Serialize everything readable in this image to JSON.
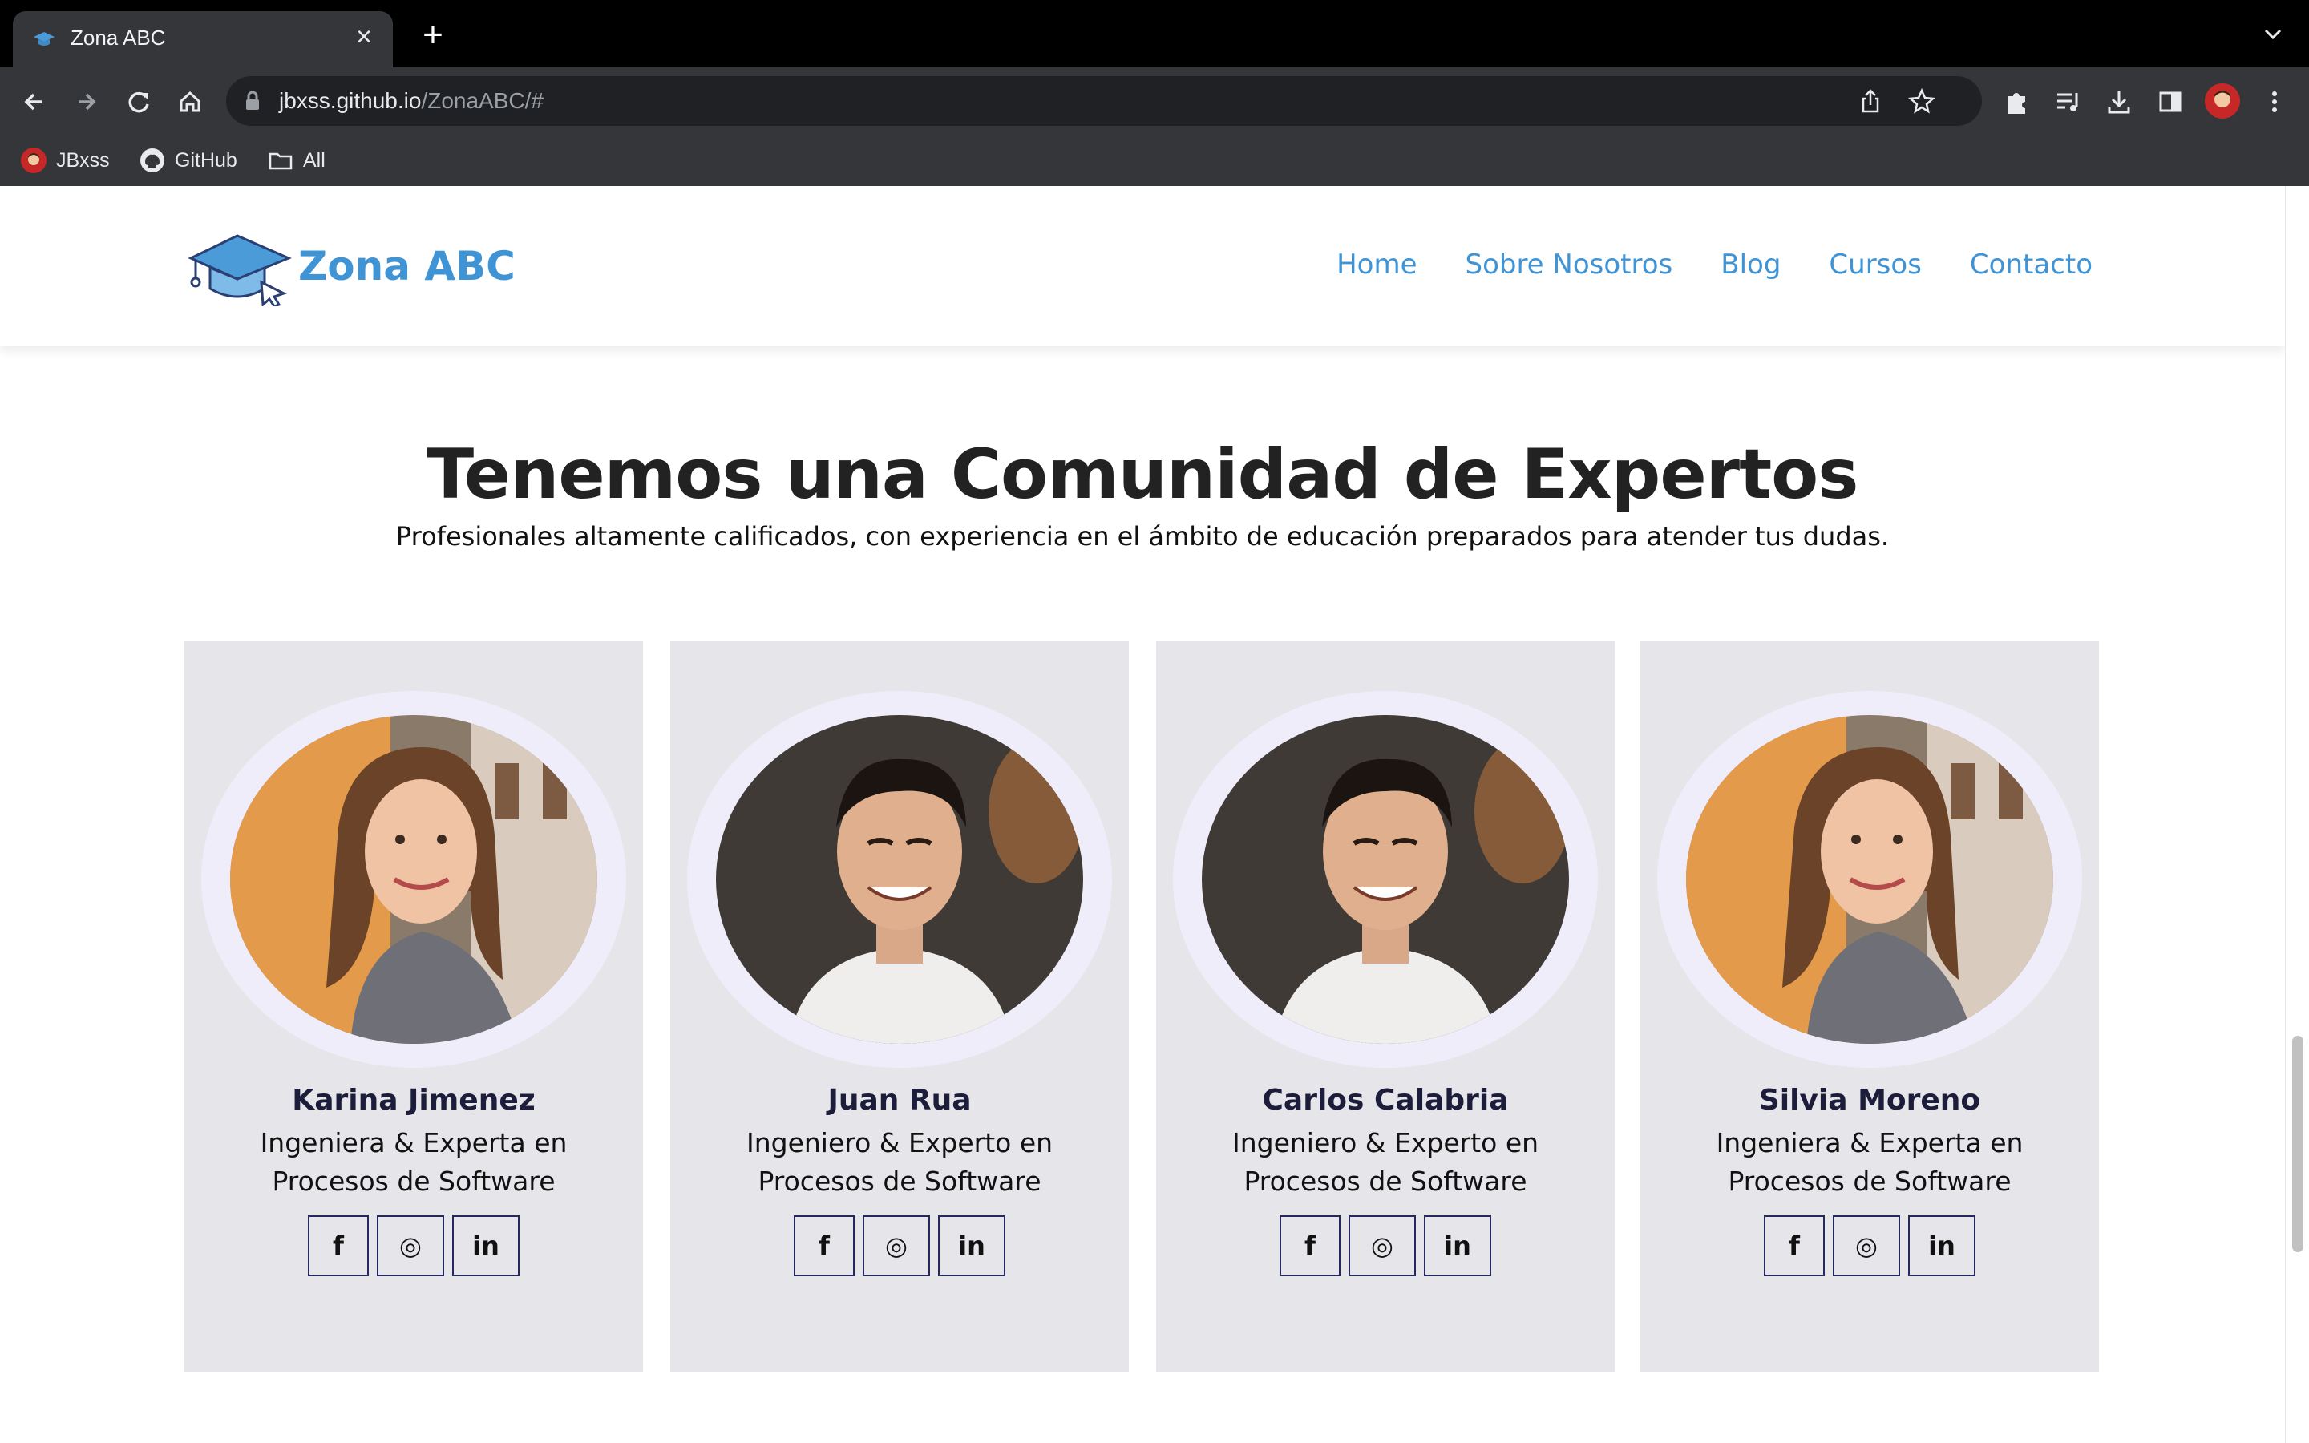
{
  "browser": {
    "tab_title": "Zona ABC",
    "url_host": "jbxss.github.io",
    "url_path": "/ZonaABC/#",
    "bookmarks": [
      {
        "label": "JBxss",
        "icon": "avatar-icon"
      },
      {
        "label": "GitHub",
        "icon": "github-icon"
      },
      {
        "label": "All",
        "icon": "folder-icon"
      }
    ]
  },
  "site": {
    "logo_text": "Zona ABC",
    "nav": [
      "Home",
      "Sobre Nosotros",
      "Blog",
      "Cursos",
      "Contacto"
    ],
    "accent_color": "#3f94d6"
  },
  "section": {
    "title": "Tenemos una Comunidad de Expertos",
    "subtitle": "Profesionales altamente calificados, con experiencia en el ámbito de educación preparados para atender tus dudas."
  },
  "experts": [
    {
      "name": "Karina Jimenez",
      "role": "Ingeniera & Experta en Procesos de Software",
      "photo": "woman"
    },
    {
      "name": "Juan Rua",
      "role": "Ingeniero & Experto en Procesos de Software",
      "photo": "man"
    },
    {
      "name": "Carlos Calabria",
      "role": "Ingeniero & Experto en Procesos de Software",
      "photo": "man"
    },
    {
      "name": "Silvia Moreno",
      "role": "Ingeniera & Experta en Procesos de Software",
      "photo": "woman"
    }
  ],
  "social_icons": {
    "facebook": "f",
    "instagram": "◎",
    "linkedin": "in"
  }
}
